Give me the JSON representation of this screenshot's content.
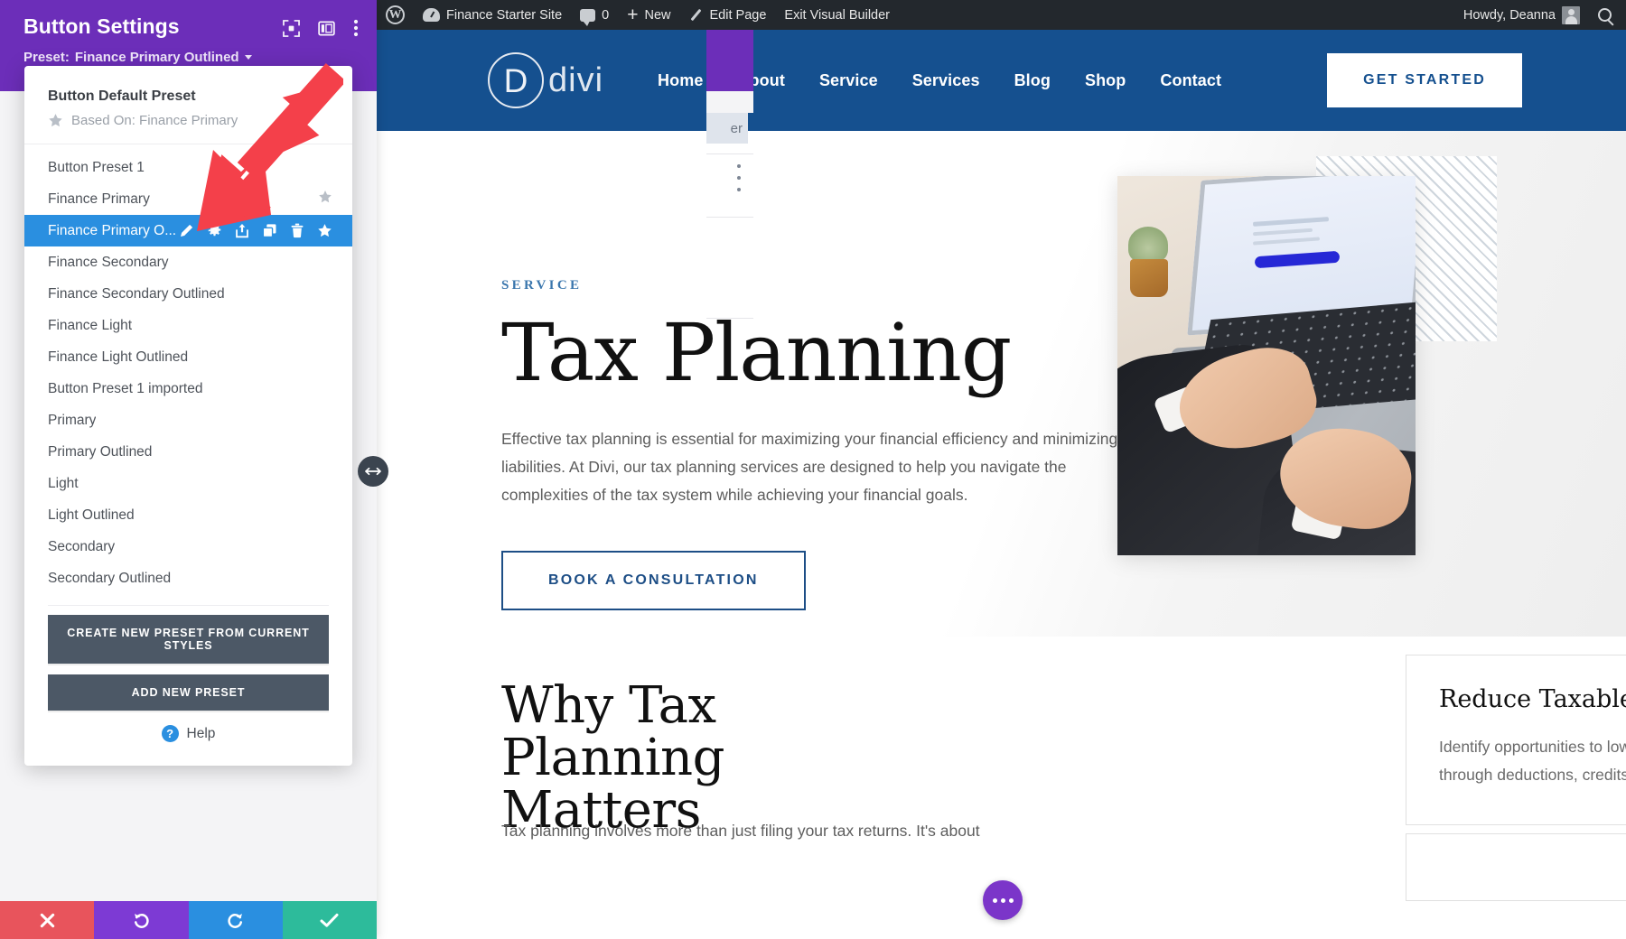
{
  "adminbar": {
    "wp_logo": "wordpress-logo-icon",
    "site_name": "Finance Starter Site",
    "comment_count": "0",
    "new_label": "New",
    "edit_page_label": "Edit Page",
    "exit_builder_label": "Exit Visual Builder",
    "howdy": "Howdy, Deanna"
  },
  "site_header": {
    "logo_letter": "D",
    "logo_word": "divi",
    "nav": [
      {
        "label": "Home"
      },
      {
        "label": "About"
      },
      {
        "label": "Service"
      },
      {
        "label": "Services"
      },
      {
        "label": "Blog"
      },
      {
        "label": "Shop"
      },
      {
        "label": "Contact"
      }
    ],
    "cta_label": "GET STARTED"
  },
  "hero": {
    "eyebrow": "SERVICE",
    "title": "Tax Planning",
    "paragraph": "Effective tax planning is essential for maximizing your financial efficiency and minimizing liabilities. At Divi, our tax planning services are designed to help you navigate the complexities of the tax system while achieving your financial goals.",
    "cta_label": "BOOK A CONSULTATION"
  },
  "lower": {
    "title": "Why Tax Planning Matters",
    "paragraph": "Tax planning involves more than just filing your tax returns. It's about",
    "card": {
      "title": "Reduce Taxable Income",
      "body": "Identify opportunities to lower your taxable income through deductions, credits, and other strategies."
    }
  },
  "ghost": {
    "tab_fragment": "er"
  },
  "panel": {
    "title": "Button Settings",
    "preset_prefix": "Preset:",
    "preset_name": "Finance Primary Outlined",
    "header_icons": [
      {
        "name": "focus-target-icon"
      },
      {
        "name": "layout-columns-icon"
      },
      {
        "name": "more-vertical-icon"
      }
    ],
    "dropdown": {
      "default_title": "Button Default Preset",
      "default_sub": "Based On: Finance Primary",
      "items": [
        {
          "label": "Button Preset 1",
          "selected": false,
          "starred": false
        },
        {
          "label": "Finance Primary",
          "selected": false,
          "starred": true
        },
        {
          "label": "Finance Primary O...",
          "selected": true,
          "starred": true
        },
        {
          "label": "Finance Secondary",
          "selected": false,
          "starred": false
        },
        {
          "label": "Finance Secondary Outlined",
          "selected": false,
          "starred": false
        },
        {
          "label": "Finance Light",
          "selected": false,
          "starred": false
        },
        {
          "label": "Finance Light Outlined",
          "selected": false,
          "starred": false
        },
        {
          "label": "Button Preset 1 imported",
          "selected": false,
          "starred": false
        },
        {
          "label": "Primary",
          "selected": false,
          "starred": false
        },
        {
          "label": "Primary Outlined",
          "selected": false,
          "starred": false
        },
        {
          "label": "Light",
          "selected": false,
          "starred": false
        },
        {
          "label": "Light Outlined",
          "selected": false,
          "starred": false
        },
        {
          "label": "Secondary",
          "selected": false,
          "starred": false
        },
        {
          "label": "Secondary Outlined",
          "selected": false,
          "starred": false
        }
      ],
      "row_actions": [
        {
          "name": "rename-pencil-icon"
        },
        {
          "name": "settings-gear-icon"
        },
        {
          "name": "export-upload-icon"
        },
        {
          "name": "duplicate-icon"
        },
        {
          "name": "delete-trash-icon"
        },
        {
          "name": "set-default-star-icon"
        }
      ],
      "create_preset_label": "CREATE NEW PRESET FROM CURRENT STYLES",
      "add_preset_label": "ADD NEW PRESET",
      "help_label": "Help",
      "help_badge": "?"
    },
    "toolbar": [
      {
        "name": "discard-changes-button",
        "icon": "close-x-icon"
      },
      {
        "name": "undo-button",
        "icon": "undo-arrow-icon"
      },
      {
        "name": "redo-button",
        "icon": "redo-arrow-icon"
      },
      {
        "name": "save-changes-button",
        "icon": "check-icon"
      }
    ]
  },
  "colors": {
    "panel_purple": "#6c2eb9",
    "selected_blue": "#2a8fe0",
    "site_blue": "#15508f",
    "accent_red_arrow": "#f4404a",
    "toolbar_close": "#e8545c",
    "toolbar_undo": "#7d3ad4",
    "toolbar_redo": "#2a8fe0",
    "toolbar_save": "#2dbb9b",
    "fab_purple": "#7b35c9"
  }
}
